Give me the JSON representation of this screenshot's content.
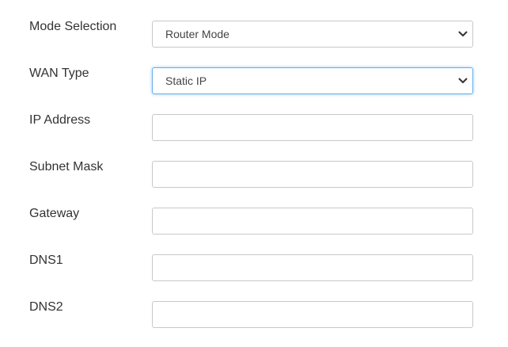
{
  "form": {
    "mode_selection": {
      "label": "Mode Selection",
      "value": "Router Mode",
      "icon": "chevron-down-icon"
    },
    "wan_type": {
      "label": "WAN Type",
      "value": "Static IP",
      "icon": "chevron-down-icon"
    },
    "ip_address": {
      "label": "IP Address",
      "value": ""
    },
    "subnet_mask": {
      "label": "Subnet Mask",
      "value": ""
    },
    "gateway": {
      "label": "Gateway",
      "value": ""
    },
    "dns1": {
      "label": "DNS1",
      "value": ""
    },
    "dns2": {
      "label": "DNS2",
      "value": ""
    }
  },
  "colors": {
    "border": "#c8c8c8",
    "focus_border": "#66afe9",
    "label_text": "#333333"
  }
}
